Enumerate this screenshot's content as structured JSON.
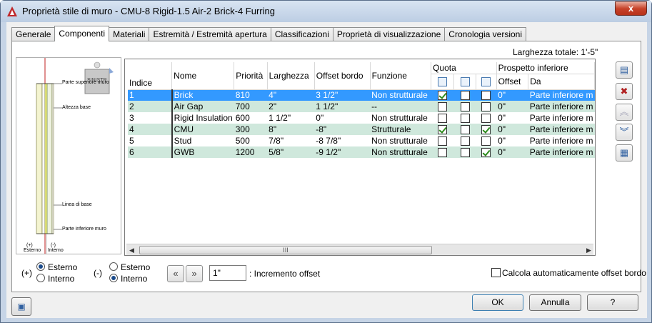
{
  "window": {
    "title": "Proprietà stile di muro - CMU-8 Rigid-1.5 Air-2 Brick-4 Furring",
    "close_label": "x"
  },
  "tabs": [
    "Generale",
    "Componenti",
    "Materiali",
    "Estremità / Estremità apertura",
    "Classificazioni",
    "Proprietà di visualizzazione",
    "Cronologia versioni"
  ],
  "total_width": "Larghezza totale: 1'-5\"",
  "preview": {
    "labels": [
      "Parte superiore muro",
      "Altezza base",
      "Linea di base",
      "Parte inferiore muro"
    ],
    "view_cube": "SINISTRA",
    "bottom_left": [
      "(+)",
      "Esterno"
    ],
    "bottom_right": [
      "(-)",
      "Interno"
    ]
  },
  "grid": {
    "group_quota": "Quota",
    "group_prospetto": "Prospetto inferiore",
    "headers": [
      "Indice",
      "Nome",
      "Priorità",
      "Larghezza",
      "Offset bordo",
      "Funzione",
      "Offset",
      "Da"
    ],
    "rows": [
      {
        "indice": "1",
        "nome": "Brick",
        "priorita": "810",
        "larghezza": "4\"",
        "offset_bordo": "3 1/2\"",
        "funzione": "Non strutturale",
        "q1": true,
        "q2": false,
        "q3": false,
        "offset": "0\"",
        "da": "Parte inferiore m"
      },
      {
        "indice": "2",
        "nome": "Air Gap",
        "priorita": "700",
        "larghezza": "2\"",
        "offset_bordo": "1 1/2\"",
        "funzione": "--",
        "q1": false,
        "q2": false,
        "q3": false,
        "offset": "0\"",
        "da": "Parte inferiore m"
      },
      {
        "indice": "3",
        "nome": "Rigid Insulation",
        "priorita": "600",
        "larghezza": "1 1/2\"",
        "offset_bordo": "0\"",
        "funzione": "Non strutturale",
        "q1": false,
        "q2": false,
        "q3": false,
        "offset": "0\"",
        "da": "Parte inferiore m"
      },
      {
        "indice": "4",
        "nome": "CMU",
        "priorita": "300",
        "larghezza": "8\"",
        "offset_bordo": "-8\"",
        "funzione": "Strutturale",
        "q1": true,
        "q2": false,
        "q3": true,
        "offset": "0\"",
        "da": "Parte inferiore m"
      },
      {
        "indice": "5",
        "nome": "Stud",
        "priorita": "500",
        "larghezza": "7/8\"",
        "offset_bordo": "-8 7/8\"",
        "funzione": "Non strutturale",
        "q1": false,
        "q2": false,
        "q3": false,
        "offset": "0\"",
        "da": "Parte inferiore m"
      },
      {
        "indice": "6",
        "nome": "GWB",
        "priorita": "1200",
        "larghezza": "5/8\"",
        "offset_bordo": "-9 1/2\"",
        "funzione": "Non strutturale",
        "q1": false,
        "q2": false,
        "q3": true,
        "offset": "0\"",
        "da": "Parte inferiore m"
      }
    ],
    "scroll_grip": "III"
  },
  "options": {
    "plus_label": "(+)",
    "minus_label": "(-)",
    "esterno": "Esterno",
    "interno": "Interno",
    "offset_value": "1\"",
    "offset_label": ": Incremento offset",
    "auto_offset": "Calcola automaticamente offset bordo"
  },
  "buttons": {
    "ok": "OK",
    "cancel": "Annulla",
    "help": "?"
  }
}
